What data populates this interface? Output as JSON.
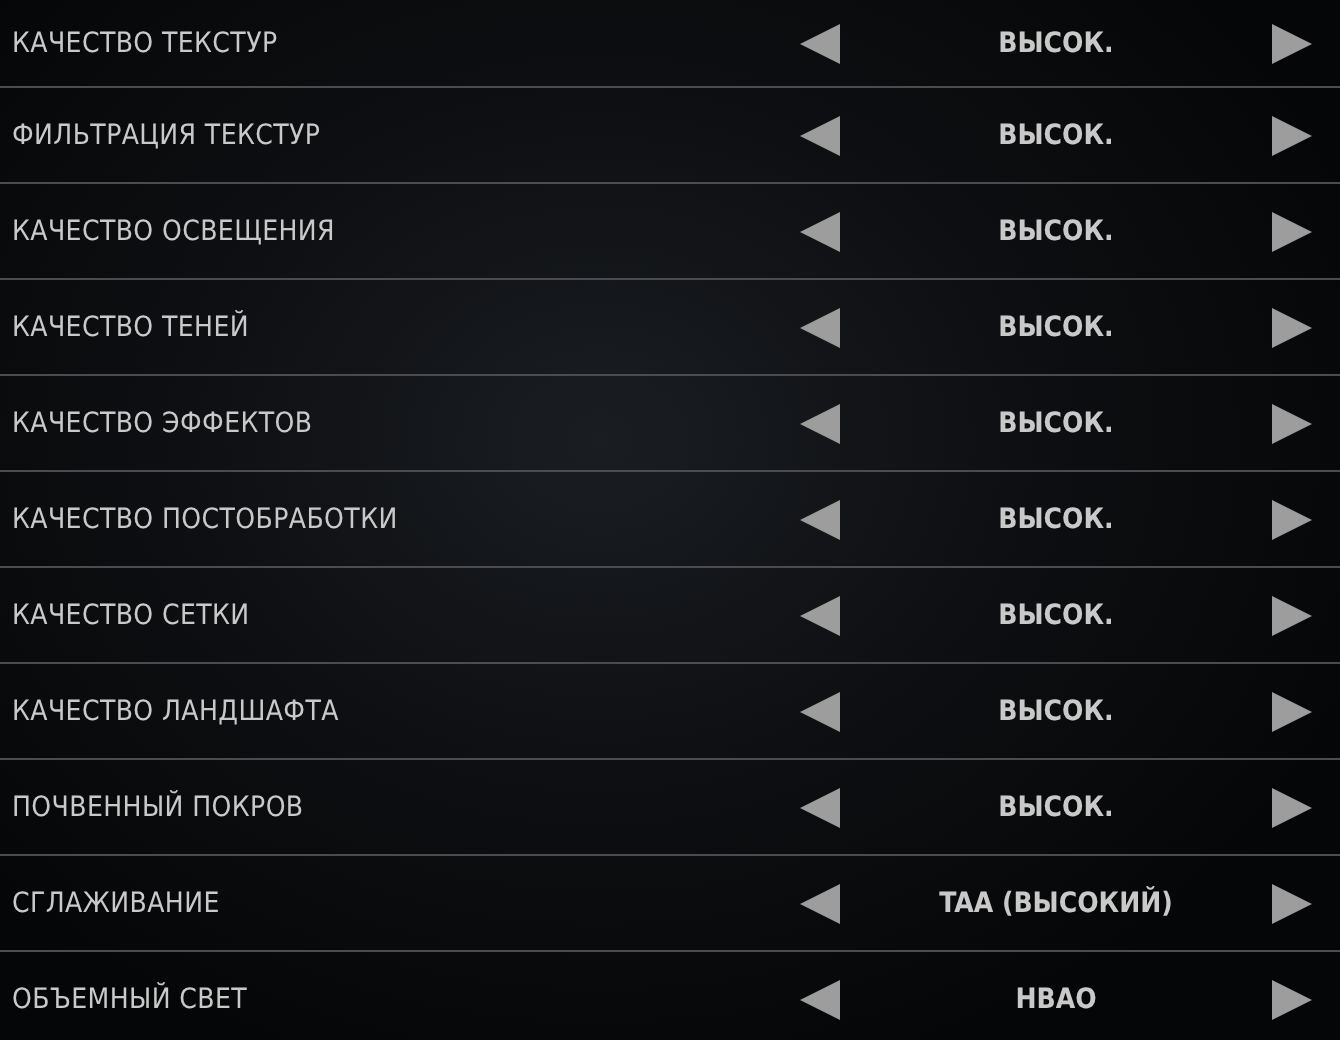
{
  "settings": [
    {
      "label": "КАЧЕСТВО ТЕКСТУР",
      "value": "ВЫСОК."
    },
    {
      "label": "ФИЛЬТРАЦИЯ ТЕКСТУР",
      "value": "ВЫСОК."
    },
    {
      "label": "КАЧЕСТВО ОСВЕЩЕНИЯ",
      "value": "ВЫСОК."
    },
    {
      "label": "КАЧЕСТВО ТЕНЕЙ",
      "value": "ВЫСОК."
    },
    {
      "label": "КАЧЕСТВО ЭФФЕКТОВ",
      "value": "ВЫСОК."
    },
    {
      "label": "КАЧЕСТВО ПОСТОБРАБОТКИ",
      "value": "ВЫСОК."
    },
    {
      "label": "КАЧЕСТВО СЕТКИ",
      "value": "ВЫСОК."
    },
    {
      "label": "КАЧЕСТВО ЛАНДШАФТА",
      "value": "ВЫСОК."
    },
    {
      "label": "ПОЧВЕННЫЙ ПОКРОВ",
      "value": "ВЫСОК."
    },
    {
      "label": "СГЛАЖИВАНИЕ",
      "value": "TAA (ВЫСОКИЙ)"
    },
    {
      "label": "ОБЪЕМНЫЙ СВЕТ",
      "value": "HBAO"
    }
  ]
}
